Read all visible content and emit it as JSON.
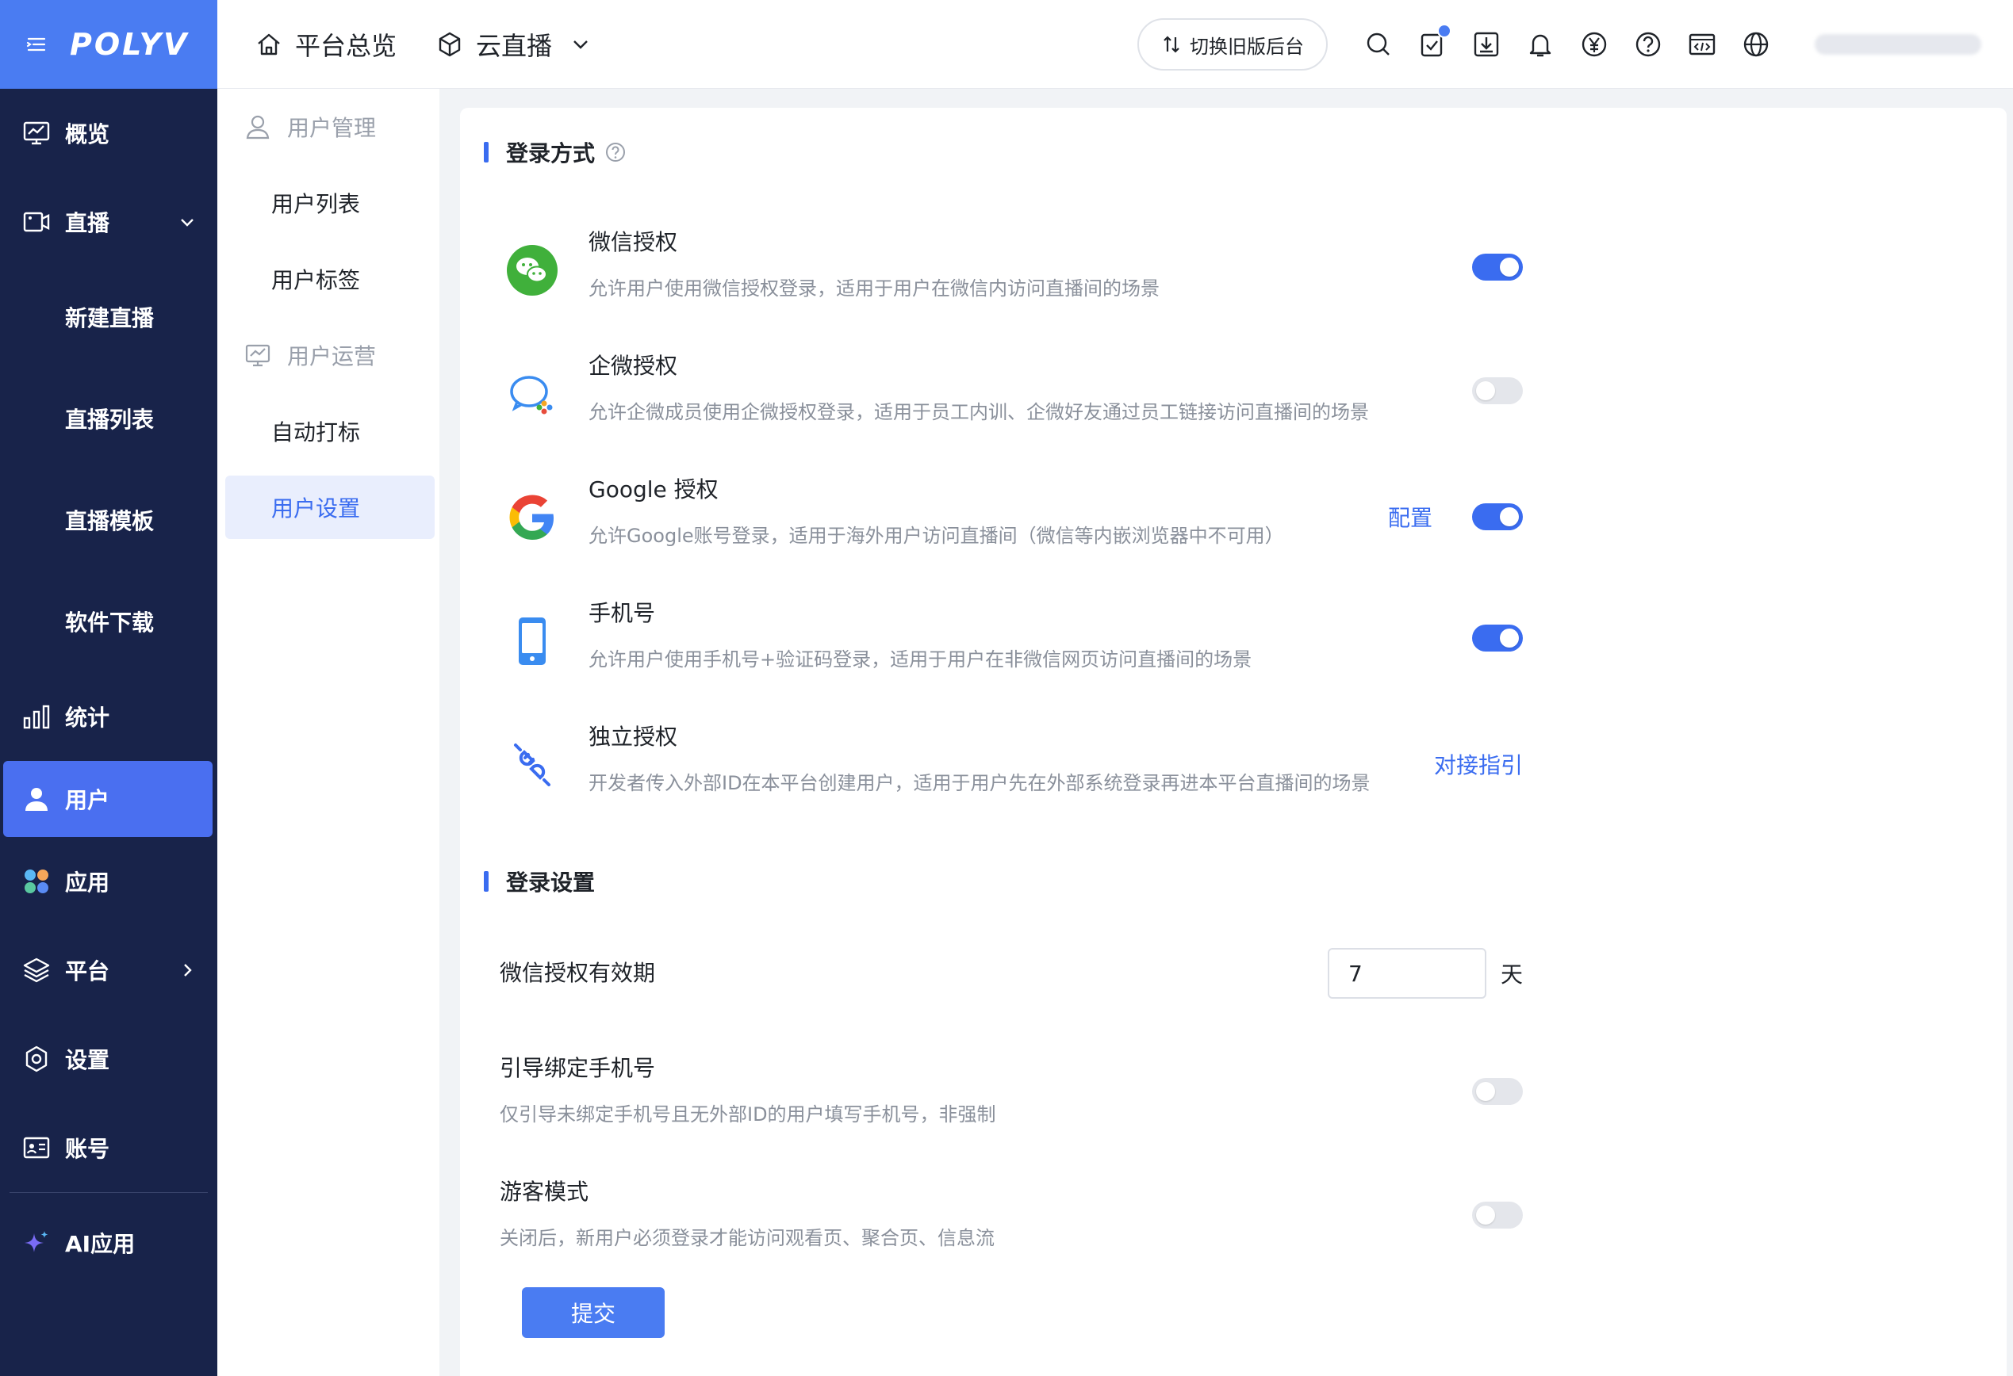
{
  "brand": {
    "logo": "POLYV"
  },
  "sidebar": {
    "items": [
      {
        "label": "概览"
      },
      {
        "label": "直播"
      },
      {
        "label": "新建直播"
      },
      {
        "label": "直播列表"
      },
      {
        "label": "直播模板"
      },
      {
        "label": "软件下载"
      },
      {
        "label": "统计"
      },
      {
        "label": "用户"
      },
      {
        "label": "应用"
      },
      {
        "label": "平台"
      },
      {
        "label": "设置"
      },
      {
        "label": "账号"
      },
      {
        "label": "AI应用"
      }
    ]
  },
  "topbar": {
    "overview": "平台总览",
    "product": "云直播",
    "switch_label": "切换旧版后台"
  },
  "submenu": {
    "group_user_manage": "用户管理",
    "user_list": "用户列表",
    "user_tags": "用户标签",
    "group_user_ops": "用户运营",
    "auto_tag": "自动打标",
    "user_settings": "用户设置"
  },
  "login_methods": {
    "title": "登录方式",
    "items": [
      {
        "title": "微信授权",
        "desc": "允许用户使用微信授权登录，适用于用户在微信内访问直播间的场景",
        "enabled": true
      },
      {
        "title": "企微授权",
        "desc": "允许企微成员使用企微授权登录，适用于员工内训、企微好友通过员工链接访问直播间的场景",
        "enabled": false
      },
      {
        "title": "Google 授权",
        "desc": "允许Google账号登录，适用于海外用户访问直播间（微信等内嵌浏览器中不可用）",
        "enabled": true,
        "link": "配置"
      },
      {
        "title": "手机号",
        "desc": "允许用户使用手机号+验证码登录，适用于用户在非微信网页访问直播间的场景",
        "enabled": true
      },
      {
        "title": "独立授权",
        "desc": "开发者传入外部ID在本平台创建用户，适用于用户先在外部系统登录再进本平台直播间的场景",
        "link": "对接指引"
      }
    ]
  },
  "login_settings": {
    "title": "登录设置",
    "wechat_validity": {
      "label": "微信授权有效期",
      "value": "7",
      "unit": "天"
    },
    "bind_phone": {
      "title": "引导绑定手机号",
      "desc": "仅引导未绑定手机号且无外部ID的用户填写手机号，非强制",
      "enabled": false
    },
    "guest_mode": {
      "title": "游客模式",
      "desc": "关闭后，新用户必须登录才能访问观看页、聚合页、信息流",
      "enabled": false
    },
    "submit": "提交"
  }
}
